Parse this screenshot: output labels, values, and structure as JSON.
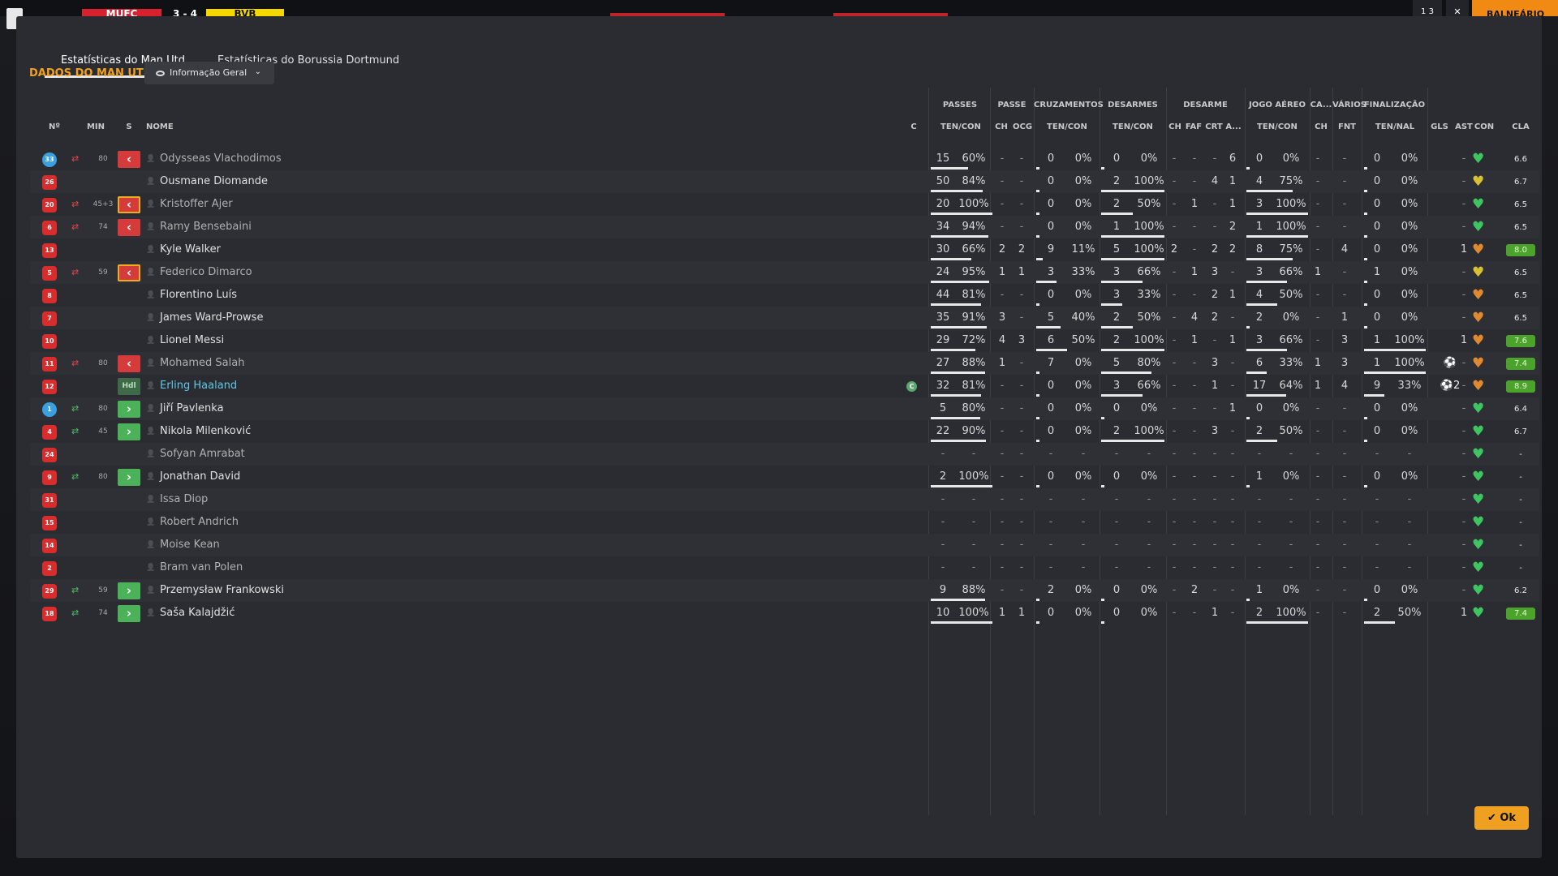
{
  "scoreboard": {
    "home": "MUFC",
    "score": "3 - 4",
    "away": "BVB"
  },
  "top_right": {
    "menu": "1 3",
    "close": "✕",
    "dressing_room": "BALNEÁRIO"
  },
  "tabs": [
    {
      "label": "Estatísticas do Man Utd",
      "active": true
    },
    {
      "label": "Estatísticas do Borussia Dortmund",
      "active": false
    }
  ],
  "team_heading": "DADOS DO MAN UTD",
  "view_select": {
    "label": "Informação Geral"
  },
  "group_headers": [
    "PASSES",
    "PASSE",
    "CRUZAMENTOS",
    "DESARMES",
    "DESARME",
    "JOGO AÉREO",
    "CA...",
    "VÁRIOS",
    "FINALIZAÇÃO"
  ],
  "sub_headers": {
    "no": "Nº",
    "min": "MIN",
    "s": "S",
    "name": "NOME",
    "c": "C",
    "passes": "TEN/CON",
    "pass_ch": "CH",
    "pass_ocg": "OCG",
    "crosses": "TEN/CON",
    "tackles": "TEN/CON",
    "des_ch": "CH",
    "des_faf": "FAF",
    "des_crt": "CRT",
    "des_a": "A...",
    "aerial": "TEN/CON",
    "ca_ch": "CH",
    "var_fnt": "FNT",
    "shots": "TEN/NAL",
    "gls": "GLS",
    "ast": "AST",
    "con": "CON",
    "cla": "CLA"
  },
  "players": [
    {
      "no": "33",
      "gk": true,
      "min": "80",
      "sub": "out",
      "s": "out",
      "name": "Odysseas Vlachodimos",
      "ns": "sub",
      "pa": "15",
      "pp": "60%",
      "pf": 0.6,
      "pch": "-",
      "pocg": "-",
      "ca": "0",
      "cp": "0%",
      "cf": 0,
      "ta": "0",
      "tp": "0%",
      "tf": 0,
      "dch": "-",
      "dfaf": "-",
      "dcrt": "-",
      "da": "6",
      "aa": "0",
      "ap": "0%",
      "af": 0,
      "cach": "-",
      "fnt": "-",
      "sa": "0",
      "sp": "0%",
      "sf": 0,
      "gls": "",
      "ast": "-",
      "heart": "#3ec460",
      "cla": "6.6",
      "hi": false
    },
    {
      "no": "26",
      "min": "",
      "sub": "",
      "s": "",
      "name": "Ousmane Diomande",
      "ns": "",
      "pa": "50",
      "pp": "84%",
      "pf": 0.84,
      "pch": "-",
      "pocg": "-",
      "ca": "0",
      "cp": "0%",
      "cf": 0,
      "ta": "2",
      "tp": "100%",
      "tf": 1,
      "dch": "-",
      "dfaf": "-",
      "dcrt": "4",
      "da": "1",
      "aa": "4",
      "ap": "75%",
      "af": 0.75,
      "cach": "-",
      "fnt": "-",
      "sa": "0",
      "sp": "0%",
      "sf": 0,
      "gls": "",
      "ast": "-",
      "heart": "#d8c030",
      "cla": "6.7",
      "hi": false
    },
    {
      "no": "20",
      "min": "45+3",
      "sub": "out",
      "s": "outy",
      "name": "Kristoffer Ajer",
      "ns": "sub",
      "pa": "20",
      "pp": "100%",
      "pf": 1,
      "pch": "-",
      "pocg": "-",
      "ca": "0",
      "cp": "0%",
      "cf": 0,
      "ta": "2",
      "tp": "50%",
      "tf": 0.5,
      "dch": "-",
      "dfaf": "1",
      "dcrt": "-",
      "da": "1",
      "aa": "3",
      "ap": "100%",
      "af": 1,
      "cach": "-",
      "fnt": "-",
      "sa": "0",
      "sp": "0%",
      "sf": 0,
      "gls": "",
      "ast": "-",
      "heart": "#3ec460",
      "cla": "6.5",
      "hi": false
    },
    {
      "no": "6",
      "min": "74",
      "sub": "out",
      "s": "out",
      "name": "Ramy Bensebaini",
      "ns": "sub",
      "pa": "34",
      "pp": "94%",
      "pf": 0.94,
      "pch": "-",
      "pocg": "-",
      "ca": "0",
      "cp": "0%",
      "cf": 0,
      "ta": "1",
      "tp": "100%",
      "tf": 1,
      "dch": "-",
      "dfaf": "-",
      "dcrt": "-",
      "da": "2",
      "aa": "1",
      "ap": "100%",
      "af": 1,
      "cach": "-",
      "fnt": "-",
      "sa": "0",
      "sp": "0%",
      "sf": 0,
      "gls": "",
      "ast": "-",
      "heart": "#3ec460",
      "cla": "6.5",
      "hi": false
    },
    {
      "no": "13",
      "min": "",
      "sub": "",
      "s": "",
      "name": "Kyle Walker",
      "ns": "",
      "pa": "30",
      "pp": "66%",
      "pf": 0.66,
      "pch": "2",
      "pocg": "2",
      "ca": "9",
      "cp": "11%",
      "cf": 0.11,
      "ta": "5",
      "tp": "100%",
      "tf": 1,
      "dch": "2",
      "dfaf": "-",
      "dcrt": "2",
      "da": "2",
      "aa": "8",
      "ap": "75%",
      "af": 0.75,
      "cach": "-",
      "fnt": "4",
      "sa": "0",
      "sp": "0%",
      "sf": 0,
      "gls": "",
      "ast": "1",
      "heart": "#e08a30",
      "cla": "8.0",
      "hi": true
    },
    {
      "no": "5",
      "min": "59",
      "sub": "out",
      "s": "outy",
      "name": "Federico Dimarco",
      "ns": "sub",
      "pa": "24",
      "pp": "95%",
      "pf": 0.95,
      "pch": "1",
      "pocg": "1",
      "ca": "3",
      "cp": "33%",
      "cf": 0.33,
      "ta": "3",
      "tp": "66%",
      "tf": 0.66,
      "dch": "-",
      "dfaf": "1",
      "dcrt": "3",
      "da": "-",
      "aa": "3",
      "ap": "66%",
      "af": 0.66,
      "cach": "1",
      "fnt": "-",
      "sa": "1",
      "sp": "0%",
      "sf": 0,
      "gls": "",
      "ast": "-",
      "heart": "#d8c030",
      "cla": "6.5",
      "hi": false
    },
    {
      "no": "8",
      "min": "",
      "sub": "",
      "s": "",
      "name": "Florentino Luís",
      "ns": "",
      "pa": "44",
      "pp": "81%",
      "pf": 0.81,
      "pch": "-",
      "pocg": "-",
      "ca": "0",
      "cp": "0%",
      "cf": 0,
      "ta": "3",
      "tp": "33%",
      "tf": 0.33,
      "dch": "-",
      "dfaf": "-",
      "dcrt": "2",
      "da": "1",
      "aa": "4",
      "ap": "50%",
      "af": 0.5,
      "cach": "-",
      "fnt": "-",
      "sa": "0",
      "sp": "0%",
      "sf": 0,
      "gls": "",
      "ast": "-",
      "heart": "#e08a30",
      "cla": "6.5",
      "hi": false
    },
    {
      "no": "7",
      "min": "",
      "sub": "",
      "s": "",
      "name": "James Ward-Prowse",
      "ns": "",
      "pa": "35",
      "pp": "91%",
      "pf": 0.91,
      "pch": "3",
      "pocg": "-",
      "ca": "5",
      "cp": "40%",
      "cf": 0.4,
      "ta": "2",
      "tp": "50%",
      "tf": 0.5,
      "dch": "-",
      "dfaf": "4",
      "dcrt": "2",
      "da": "-",
      "aa": "2",
      "ap": "0%",
      "af": 0,
      "cach": "-",
      "fnt": "1",
      "sa": "0",
      "sp": "0%",
      "sf": 0,
      "gls": "",
      "ast": "-",
      "heart": "#e08a30",
      "cla": "6.5",
      "hi": false
    },
    {
      "no": "10",
      "min": "",
      "sub": "",
      "s": "",
      "name": "Lionel Messi",
      "ns": "",
      "pa": "29",
      "pp": "72%",
      "pf": 0.72,
      "pch": "4",
      "pocg": "3",
      "ca": "6",
      "cp": "50%",
      "cf": 0.5,
      "ta": "2",
      "tp": "100%",
      "tf": 1,
      "dch": "-",
      "dfaf": "1",
      "dcrt": "-",
      "da": "1",
      "aa": "3",
      "ap": "66%",
      "af": 0.66,
      "cach": "-",
      "fnt": "3",
      "sa": "1",
      "sp": "100%",
      "sf": 1,
      "gls": "",
      "ast": "1",
      "heart": "#e08a30",
      "cla": "7.6",
      "hi": true
    },
    {
      "no": "11",
      "min": "80",
      "sub": "out",
      "s": "out",
      "name": "Mohamed Salah",
      "ns": "sub",
      "pa": "27",
      "pp": "88%",
      "pf": 0.88,
      "pch": "1",
      "pocg": "-",
      "ca": "7",
      "cp": "0%",
      "cf": 0,
      "ta": "5",
      "tp": "80%",
      "tf": 0.8,
      "dch": "-",
      "dfaf": "-",
      "dcrt": "3",
      "da": "-",
      "aa": "6",
      "ap": "33%",
      "af": 0.33,
      "cach": "1",
      "fnt": "3",
      "sa": "1",
      "sp": "100%",
      "sf": 1,
      "gls": "⚽",
      "ast": "-",
      "heart": "#e08a30",
      "cla": "7.4",
      "hi": true
    },
    {
      "no": "12",
      "min": "",
      "sub": "",
      "s": "hol",
      "sl": "Hdl",
      "name": "Erling Haaland",
      "ns": "star",
      "cap": "C",
      "pa": "32",
      "pp": "81%",
      "pf": 0.81,
      "pch": "-",
      "pocg": "-",
      "ca": "0",
      "cp": "0%",
      "cf": 0,
      "ta": "3",
      "tp": "66%",
      "tf": 0.66,
      "dch": "-",
      "dfaf": "-",
      "dcrt": "1",
      "da": "-",
      "aa": "17",
      "ap": "64%",
      "af": 0.64,
      "cach": "1",
      "fnt": "4",
      "sa": "9",
      "sp": "33%",
      "sf": 0.33,
      "gls": "⚽2",
      "ast": "-",
      "heart": "#e08a30",
      "cla": "8.9",
      "hi": true
    },
    {
      "no": "1",
      "gk": true,
      "min": "80",
      "sub": "in",
      "s": "in",
      "name": "Jiří Pavlenka",
      "ns": "",
      "pa": "5",
      "pp": "80%",
      "pf": 0.8,
      "pch": "-",
      "pocg": "-",
      "ca": "0",
      "cp": "0%",
      "cf": 0,
      "ta": "0",
      "tp": "0%",
      "tf": 0,
      "dch": "-",
      "dfaf": "-",
      "dcrt": "-",
      "da": "1",
      "aa": "0",
      "ap": "0%",
      "af": 0,
      "cach": "-",
      "fnt": "-",
      "sa": "0",
      "sp": "0%",
      "sf": 0,
      "gls": "",
      "ast": "-",
      "heart": "#3ec460",
      "cla": "6.4",
      "hi": false
    },
    {
      "no": "4",
      "min": "45",
      "sub": "in",
      "s": "in",
      "name": "Nikola Milenković",
      "ns": "",
      "pa": "22",
      "pp": "90%",
      "pf": 0.9,
      "pch": "-",
      "pocg": "-",
      "ca": "0",
      "cp": "0%",
      "cf": 0,
      "ta": "2",
      "tp": "100%",
      "tf": 1,
      "dch": "-",
      "dfaf": "-",
      "dcrt": "3",
      "da": "-",
      "aa": "2",
      "ap": "50%",
      "af": 0.5,
      "cach": "-",
      "fnt": "-",
      "sa": "0",
      "sp": "0%",
      "sf": 0,
      "gls": "",
      "ast": "-",
      "heart": "#3ec460",
      "cla": "6.7",
      "hi": false
    },
    {
      "no": "24",
      "min": "",
      "sub": "",
      "s": "",
      "name": "Sofyan Amrabat",
      "ns": "sub",
      "pa": "-",
      "pp": "-",
      "pf": 0,
      "pch": "-",
      "pocg": "-",
      "ca": "-",
      "cp": "-",
      "cf": 0,
      "ta": "-",
      "tp": "-",
      "tf": 0,
      "dch": "-",
      "dfaf": "-",
      "dcrt": "-",
      "da": "-",
      "aa": "-",
      "ap": "-",
      "af": 0,
      "cach": "-",
      "fnt": "-",
      "sa": "-",
      "sp": "-",
      "sf": 0,
      "gls": "",
      "ast": "-",
      "heart": "#3ec460",
      "cla": "-",
      "hi": false
    },
    {
      "no": "9",
      "min": "80",
      "sub": "in",
      "s": "in",
      "name": "Jonathan David",
      "ns": "",
      "pa": "2",
      "pp": "100%",
      "pf": 1,
      "pch": "-",
      "pocg": "-",
      "ca": "0",
      "cp": "0%",
      "cf": 0,
      "ta": "0",
      "tp": "0%",
      "tf": 0,
      "dch": "-",
      "dfaf": "-",
      "dcrt": "-",
      "da": "-",
      "aa": "1",
      "ap": "0%",
      "af": 0,
      "cach": "-",
      "fnt": "-",
      "sa": "0",
      "sp": "0%",
      "sf": 0,
      "gls": "",
      "ast": "-",
      "heart": "#3ec460",
      "cla": "-",
      "hi": false
    },
    {
      "no": "31",
      "min": "",
      "sub": "",
      "s": "",
      "name": "Issa Diop",
      "ns": "sub",
      "pa": "-",
      "pp": "-",
      "pf": 0,
      "pch": "-",
      "pocg": "-",
      "ca": "-",
      "cp": "-",
      "cf": 0,
      "ta": "-",
      "tp": "-",
      "tf": 0,
      "dch": "-",
      "dfaf": "-",
      "dcrt": "-",
      "da": "-",
      "aa": "-",
      "ap": "-",
      "af": 0,
      "cach": "-",
      "fnt": "-",
      "sa": "-",
      "sp": "-",
      "sf": 0,
      "gls": "",
      "ast": "-",
      "heart": "#3ec460",
      "cla": "-",
      "hi": false
    },
    {
      "no": "15",
      "min": "",
      "sub": "",
      "s": "",
      "name": "Robert Andrich",
      "ns": "sub",
      "pa": "-",
      "pp": "-",
      "pf": 0,
      "pch": "-",
      "pocg": "-",
      "ca": "-",
      "cp": "-",
      "cf": 0,
      "ta": "-",
      "tp": "-",
      "tf": 0,
      "dch": "-",
      "dfaf": "-",
      "dcrt": "-",
      "da": "-",
      "aa": "-",
      "ap": "-",
      "af": 0,
      "cach": "-",
      "fnt": "-",
      "sa": "-",
      "sp": "-",
      "sf": 0,
      "gls": "",
      "ast": "-",
      "heart": "#3ec460",
      "cla": "-",
      "hi": false
    },
    {
      "no": "14",
      "min": "",
      "sub": "",
      "s": "",
      "name": "Moise Kean",
      "ns": "sub",
      "pa": "-",
      "pp": "-",
      "pf": 0,
      "pch": "-",
      "pocg": "-",
      "ca": "-",
      "cp": "-",
      "cf": 0,
      "ta": "-",
      "tp": "-",
      "tf": 0,
      "dch": "-",
      "dfaf": "-",
      "dcrt": "-",
      "da": "-",
      "aa": "-",
      "ap": "-",
      "af": 0,
      "cach": "-",
      "fnt": "-",
      "sa": "-",
      "sp": "-",
      "sf": 0,
      "gls": "",
      "ast": "-",
      "heart": "#3ec460",
      "cla": "-",
      "hi": false
    },
    {
      "no": "2",
      "min": "",
      "sub": "",
      "s": "",
      "name": "Bram van Polen",
      "ns": "sub",
      "pa": "-",
      "pp": "-",
      "pf": 0,
      "pch": "-",
      "pocg": "-",
      "ca": "-",
      "cp": "-",
      "cf": 0,
      "ta": "-",
      "tp": "-",
      "tf": 0,
      "dch": "-",
      "dfaf": "-",
      "dcrt": "-",
      "da": "-",
      "aa": "-",
      "ap": "-",
      "af": 0,
      "cach": "-",
      "fnt": "-",
      "sa": "-",
      "sp": "-",
      "sf": 0,
      "gls": "",
      "ast": "-",
      "heart": "#3ec460",
      "cla": "-",
      "hi": false
    },
    {
      "no": "29",
      "min": "59",
      "sub": "in",
      "s": "in",
      "name": "Przemysław Frankowski",
      "ns": "",
      "pa": "9",
      "pp": "88%",
      "pf": 0.88,
      "pch": "-",
      "pocg": "-",
      "ca": "2",
      "cp": "0%",
      "cf": 0,
      "ta": "0",
      "tp": "0%",
      "tf": 0,
      "dch": "-",
      "dfaf": "2",
      "dcrt": "-",
      "da": "-",
      "aa": "1",
      "ap": "0%",
      "af": 0,
      "cach": "-",
      "fnt": "-",
      "sa": "0",
      "sp": "0%",
      "sf": 0,
      "gls": "",
      "ast": "-",
      "heart": "#3ec460",
      "cla": "6.2",
      "hi": false
    },
    {
      "no": "18",
      "min": "74",
      "sub": "in",
      "s": "in",
      "name": "Saša Kalajdžić",
      "ns": "",
      "pa": "10",
      "pp": "100%",
      "pf": 1,
      "pch": "1",
      "pocg": "1",
      "ca": "0",
      "cp": "0%",
      "cf": 0,
      "ta": "0",
      "tp": "0%",
      "tf": 0,
      "dch": "-",
      "dfaf": "-",
      "dcrt": "1",
      "da": "-",
      "aa": "2",
      "ap": "100%",
      "af": 1,
      "cach": "-",
      "fnt": "-",
      "sa": "2",
      "sp": "50%",
      "sf": 0.5,
      "gls": "",
      "ast": "1",
      "heart": "#3ec460",
      "cla": "7.4",
      "hi": true
    }
  ],
  "ok_button": {
    "label": "Ok"
  }
}
